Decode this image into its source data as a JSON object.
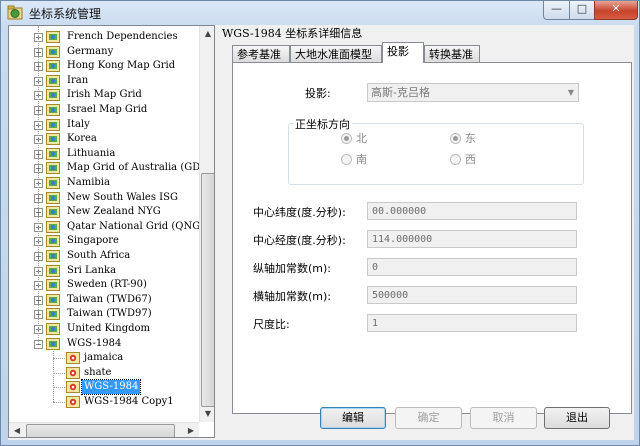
{
  "window": {
    "title": "坐标系统管理",
    "min_label": "—",
    "max_label": "□",
    "close_label": "✕"
  },
  "tree": {
    "items": [
      {
        "label": "French Dependencies",
        "level": 0,
        "expander": "+"
      },
      {
        "label": "Germany",
        "level": 0,
        "expander": "+"
      },
      {
        "label": "Hong Kong Map Grid",
        "level": 0,
        "expander": "+"
      },
      {
        "label": "Iran",
        "level": 0,
        "expander": "+"
      },
      {
        "label": "Irish Map Grid",
        "level": 0,
        "expander": "+"
      },
      {
        "label": "Israel Map Grid",
        "level": 0,
        "expander": "+"
      },
      {
        "label": "Italy",
        "level": 0,
        "expander": "+"
      },
      {
        "label": "Korea",
        "level": 0,
        "expander": "+"
      },
      {
        "label": "Lithuania",
        "level": 0,
        "expander": "+"
      },
      {
        "label": "Map Grid of Australia (GD",
        "level": 0,
        "expander": "+"
      },
      {
        "label": "Namibia",
        "level": 0,
        "expander": "+"
      },
      {
        "label": "New South Wales ISG",
        "level": 0,
        "expander": "+"
      },
      {
        "label": "New Zealand NYG",
        "level": 0,
        "expander": "+"
      },
      {
        "label": "Qatar National Grid (QNG)",
        "level": 0,
        "expander": "+"
      },
      {
        "label": "Singapore",
        "level": 0,
        "expander": "+"
      },
      {
        "label": "South Africa",
        "level": 0,
        "expander": "+"
      },
      {
        "label": "Sri Lanka",
        "level": 0,
        "expander": "+"
      },
      {
        "label": "Sweden (RT-90)",
        "level": 0,
        "expander": "+"
      },
      {
        "label": "Taiwan (TWD67)",
        "level": 0,
        "expander": "+"
      },
      {
        "label": "Taiwan (TWD97)",
        "level": 0,
        "expander": "+"
      },
      {
        "label": "United Kingdom",
        "level": 0,
        "expander": "+"
      },
      {
        "label": "WGS-1984",
        "level": 0,
        "expander": "−"
      },
      {
        "label": "jamaica",
        "level": 1
      },
      {
        "label": "shate",
        "level": 1
      },
      {
        "label": "WGS-1984",
        "level": 1,
        "selected": true
      },
      {
        "label": "WGS-1984 Copy1",
        "level": 1
      }
    ]
  },
  "detail": {
    "title": "WGS-1984 坐标系详细信息",
    "tabs": [
      "参考基准",
      "大地水准面模型",
      "投影",
      "转换基准"
    ],
    "active_tab": 2,
    "projection_label": "投影:",
    "projection_value": "高斯-克吕格",
    "direction_group": "正坐标方向",
    "radios": {
      "north": "北",
      "south": "南",
      "east": "东",
      "west": "西"
    },
    "fields": [
      {
        "label": "中心纬度(度.分秒):",
        "value": "00.000000"
      },
      {
        "label": "中心经度(度.分秒):",
        "value": "114.000000"
      },
      {
        "label": "纵轴加常数(m):",
        "value": "0"
      },
      {
        "label": "横轴加常数(m):",
        "value": "500000"
      },
      {
        "label": "尺度比:",
        "value": "1"
      }
    ]
  },
  "buttons": {
    "edit": "编辑",
    "ok": "确定",
    "cancel": "取消",
    "exit": "退出"
  },
  "colors": {
    "selection": "#3399ff",
    "close_button": "#c7432c",
    "frame": "#c8daef"
  }
}
